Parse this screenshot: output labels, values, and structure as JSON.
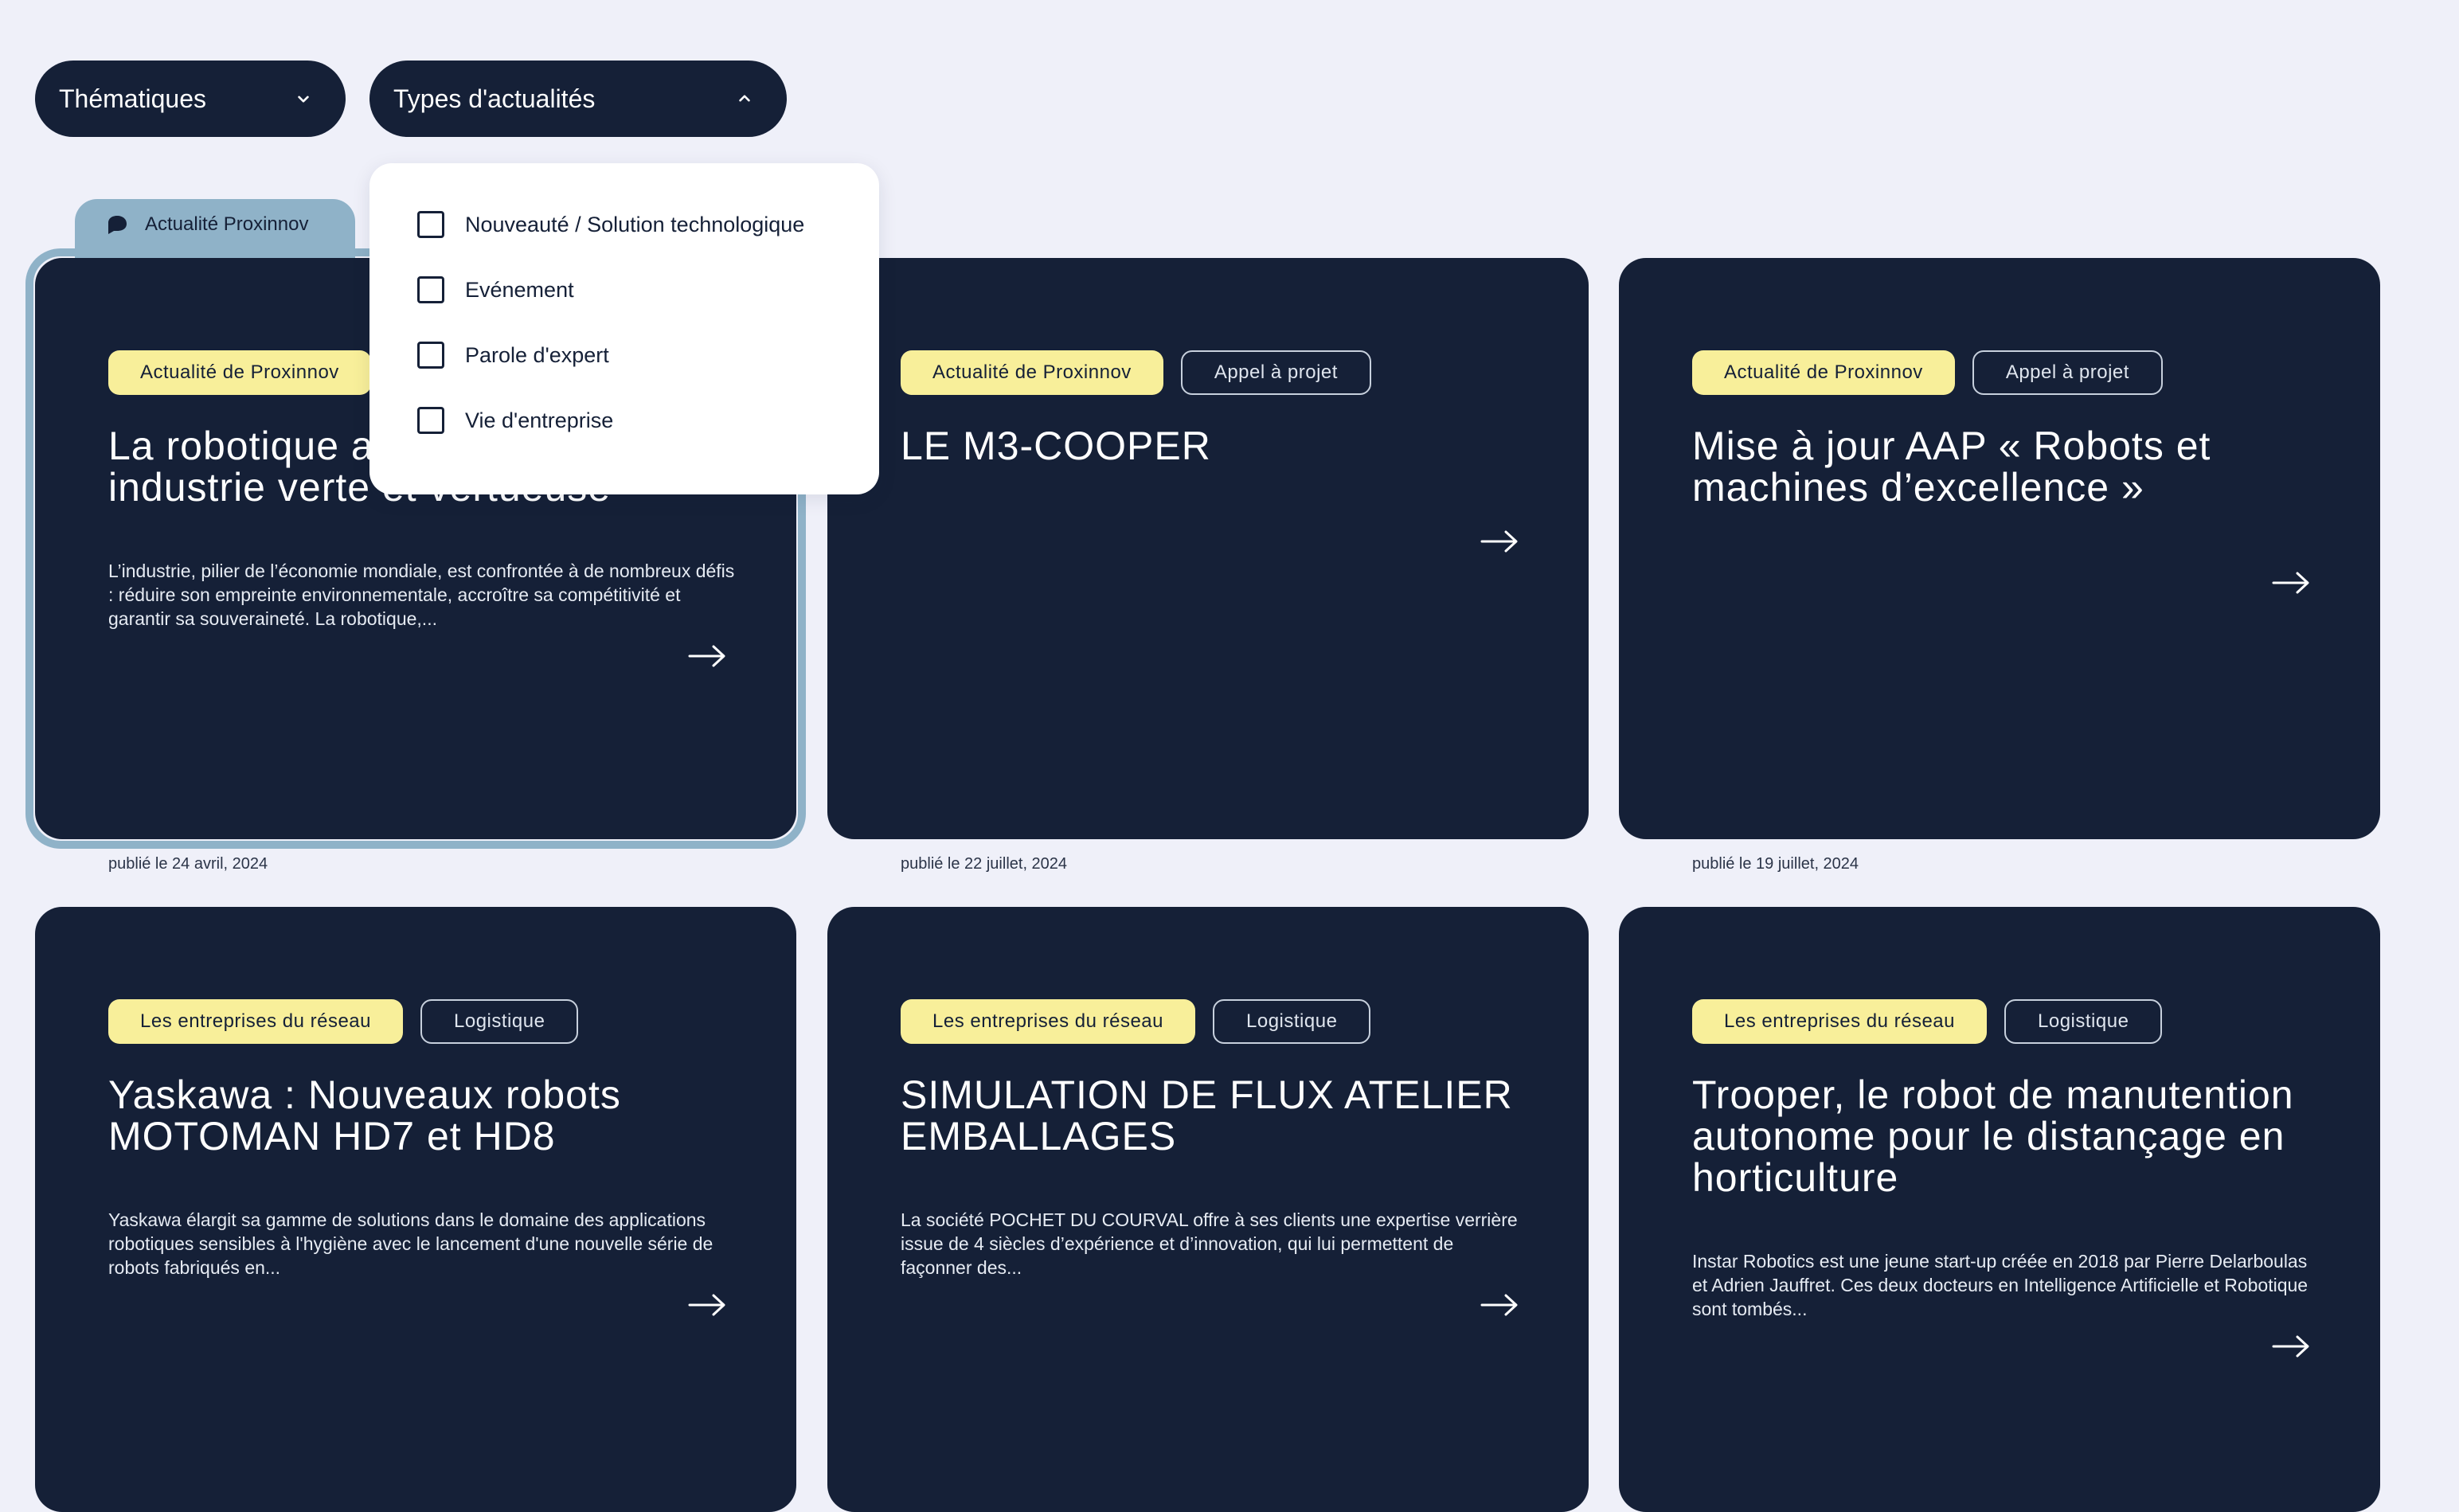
{
  "filters": {
    "thematiques_label": "Thématiques",
    "types_label": "Types d'actualités"
  },
  "types_dropdown": {
    "options": [
      {
        "label": "Nouveauté / Solution technologique",
        "checked": false
      },
      {
        "label": "Evénement",
        "checked": false
      },
      {
        "label": "Parole d'expert",
        "checked": false
      },
      {
        "label": "Vie d'entreprise",
        "checked": false
      }
    ]
  },
  "featured_badge": {
    "label": "Actualité Proxinnov",
    "icon": "proxinnov-logo-icon"
  },
  "cards": [
    {
      "tags": [
        "Actualité de Proxinnov"
      ],
      "title": "La robotique au service d'une industrie verte et vertueuse",
      "excerpt": "L’industrie, pilier de l’économie mondiale, est confrontée à de nombreux défis : réduire son empreinte environnementale, accroître sa compétitivité et garantir sa souveraineté. La robotique,...",
      "date": "publié le 24 avril, 2024"
    },
    {
      "tags": [
        "Actualité de Proxinnov",
        "Appel à projet"
      ],
      "title": "LE M3-COOPER",
      "excerpt": "",
      "date": "publié le 22 juillet, 2024"
    },
    {
      "tags": [
        "Actualité de Proxinnov",
        "Appel à projet"
      ],
      "title": "Mise à jour AAP « Robots et machines d’excellence »",
      "excerpt": "",
      "date": "publié le 19 juillet, 2024"
    },
    {
      "tags": [
        "Les entreprises du réseau",
        "Logistique"
      ],
      "title": "Yaskawa : Nouveaux robots MOTOMAN HD7 et HD8",
      "excerpt": "Yaskawa élargit sa gamme de solutions dans le domaine des applications robotiques sensibles à l'hygiène avec le lancement d'une nouvelle série de robots fabriqués en...",
      "date": ""
    },
    {
      "tags": [
        "Les entreprises du réseau",
        "Logistique"
      ],
      "title": "SIMULATION DE FLUX ATELIER EMBALLAGES",
      "excerpt": "La société POCHET DU COURVAL offre à ses clients une expertise verrière issue de 4 siècles d’expérience et d’innovation, qui lui permettent de façonner des...",
      "date": ""
    },
    {
      "tags": [
        "Les entreprises du réseau",
        "Logistique"
      ],
      "title": "Trooper, le robot de manutention autonome pour le distançage en horticulture",
      "excerpt": "Instar Robotics est une jeune start-up créée en 2018 par Pierre Delarboulas et Adrien Jauffret. Ces deux docteurs en Intelligence Artificielle et Robotique sont tombés...",
      "date": ""
    }
  ],
  "colors": {
    "background": "#eff0f9",
    "card": "#152037",
    "tag_yellow": "#f8ef9a",
    "featured_accent": "#8fb2c8"
  }
}
